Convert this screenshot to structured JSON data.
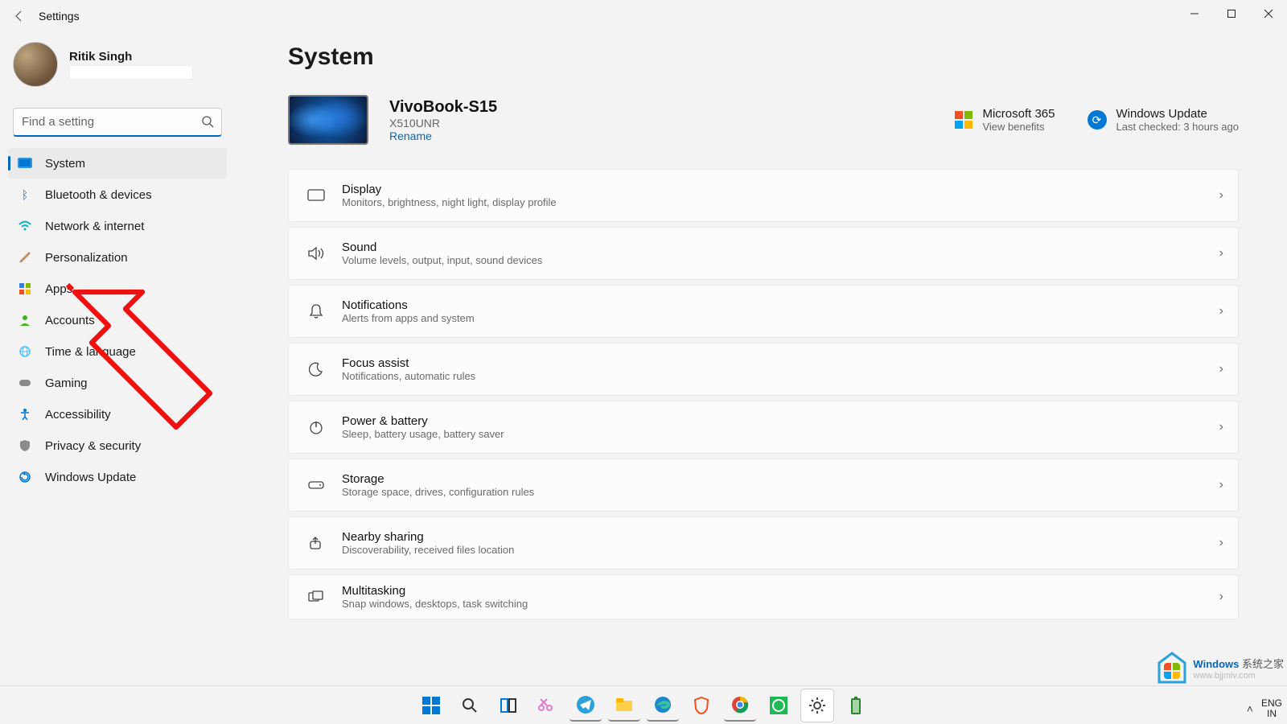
{
  "window": {
    "title": "Settings"
  },
  "user": {
    "name": "Ritik Singh"
  },
  "search": {
    "placeholder": "Find a setting"
  },
  "sidebar": {
    "items": [
      {
        "label": "System",
        "active": true,
        "iconColor": "#0078d4"
      },
      {
        "label": "Bluetooth & devices",
        "iconColor": "#0078d4"
      },
      {
        "label": "Network & internet",
        "iconColor": "#00b7c3"
      },
      {
        "label": "Personalization",
        "iconColor": "#c39163"
      },
      {
        "label": "Apps",
        "iconColor": "#3a7de0"
      },
      {
        "label": "Accounts",
        "iconColor": "#3fb618"
      },
      {
        "label": "Time & language",
        "iconColor": "#4dc2ff"
      },
      {
        "label": "Gaming",
        "iconColor": "#7a7a7a"
      },
      {
        "label": "Accessibility",
        "iconColor": "#0078d4"
      },
      {
        "label": "Privacy & security",
        "iconColor": "#8a8a8a"
      },
      {
        "label": "Windows Update",
        "iconColor": "#0078d4"
      }
    ]
  },
  "main": {
    "pageTitle": "System",
    "device": {
      "name": "VivoBook-S15",
      "model": "X510UNR",
      "renameLabel": "Rename"
    },
    "status": {
      "m365": {
        "title": "Microsoft 365",
        "sub": "View benefits"
      },
      "update": {
        "title": "Windows Update",
        "sub": "Last checked: 3 hours ago"
      }
    },
    "cards": [
      {
        "title": "Display",
        "sub": "Monitors, brightness, night light, display profile"
      },
      {
        "title": "Sound",
        "sub": "Volume levels, output, input, sound devices"
      },
      {
        "title": "Notifications",
        "sub": "Alerts from apps and system"
      },
      {
        "title": "Focus assist",
        "sub": "Notifications, automatic rules"
      },
      {
        "title": "Power & battery",
        "sub": "Sleep, battery usage, battery saver"
      },
      {
        "title": "Storage",
        "sub": "Storage space, drives, configuration rules"
      },
      {
        "title": "Nearby sharing",
        "sub": "Discoverability, received files location"
      },
      {
        "title": "Multitasking",
        "sub": "Snap windows, desktops, task switching"
      }
    ]
  },
  "taskbar": {
    "lang1": "ENG",
    "lang2": "IN"
  },
  "watermark": {
    "line1a": "Windows",
    "line1b": "系统之家",
    "line2": "www.bjjmlv.com"
  }
}
